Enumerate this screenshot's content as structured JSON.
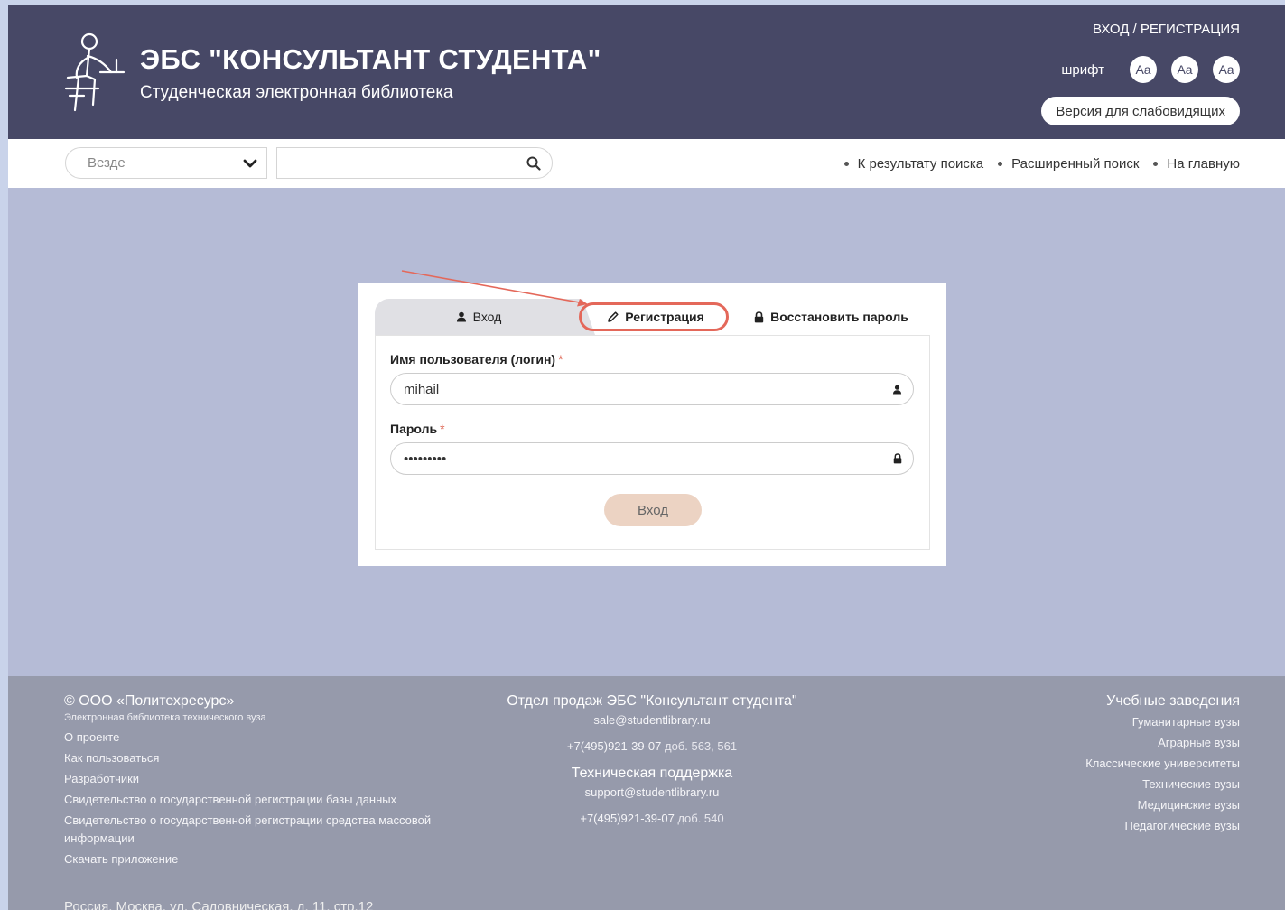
{
  "header": {
    "title": "ЭБС \"КОНСУЛЬТАНТ СТУДЕНТА\"",
    "subtitle": "Студенческая электронная библиотека",
    "auth_link": "ВХОД / РЕГИСТРАЦИЯ",
    "font_label": "шрифт",
    "font_buttons": [
      "Aa",
      "Aa",
      "Aa"
    ],
    "vision_button": "Версия для слабовидящих"
  },
  "search": {
    "scope_value": "Везде",
    "query_value": ""
  },
  "nav": {
    "links": [
      "К результату поиска",
      "Расширенный поиск",
      "На главную"
    ]
  },
  "login": {
    "tabs": {
      "login": "Вход",
      "register": "Регистрация",
      "restore": "Восстановить пароль"
    },
    "username_label": "Имя пользователя (логин)",
    "username_value": "mihail",
    "password_label": "Пароль",
    "password_value": "•••••••••",
    "required_mark": "*",
    "submit_label": "Вход"
  },
  "footer": {
    "copyright": "© ООО «Политехресурс»",
    "tagline": "Электронная библиотека технического вуза",
    "links": [
      "О проекте",
      "Как пользоваться",
      "Разработчики",
      "Свидетельство о государственной регистрации базы данных",
      "Свидетельство о государственной регистрации средства массовой информации",
      "Скачать приложение"
    ],
    "address": "Россия, Москва, ул. Садовническая, д. 11, стр.12",
    "sales_title": "Отдел продаж ЭБС \"Консультант студента\"",
    "sales_email": "sale@studentlibrary.ru",
    "sales_phone": "+7(495)921-39-07",
    "sales_ext": "доб. 563, 561",
    "support_title": "Техническая поддержка",
    "support_email": "support@studentlibrary.ru",
    "support_phone": "+7(495)921-39-07",
    "support_ext": "доб. 540",
    "unis_title": "Учебные заведения",
    "unis": [
      "Гуманитарные вузы",
      "Аграрные вузы",
      "Классические университеты",
      "Технические вузы",
      "Медицинские вузы",
      "Педагогические вузы"
    ]
  },
  "colors": {
    "header_bg": "#474866",
    "page_bg": "#b5bbd6",
    "footer_bg": "#969aab",
    "highlight": "#e4685a",
    "button_bg": "#ecd3c3"
  },
  "icons": {
    "logo": "student-at-desk-icon",
    "scope": "chevron-down-icon",
    "search": "search-icon",
    "login_tab": "user-icon",
    "register_tab": "pencil-icon",
    "restore_tab": "lock-icon",
    "username": "user-icon",
    "password": "lock-icon"
  }
}
